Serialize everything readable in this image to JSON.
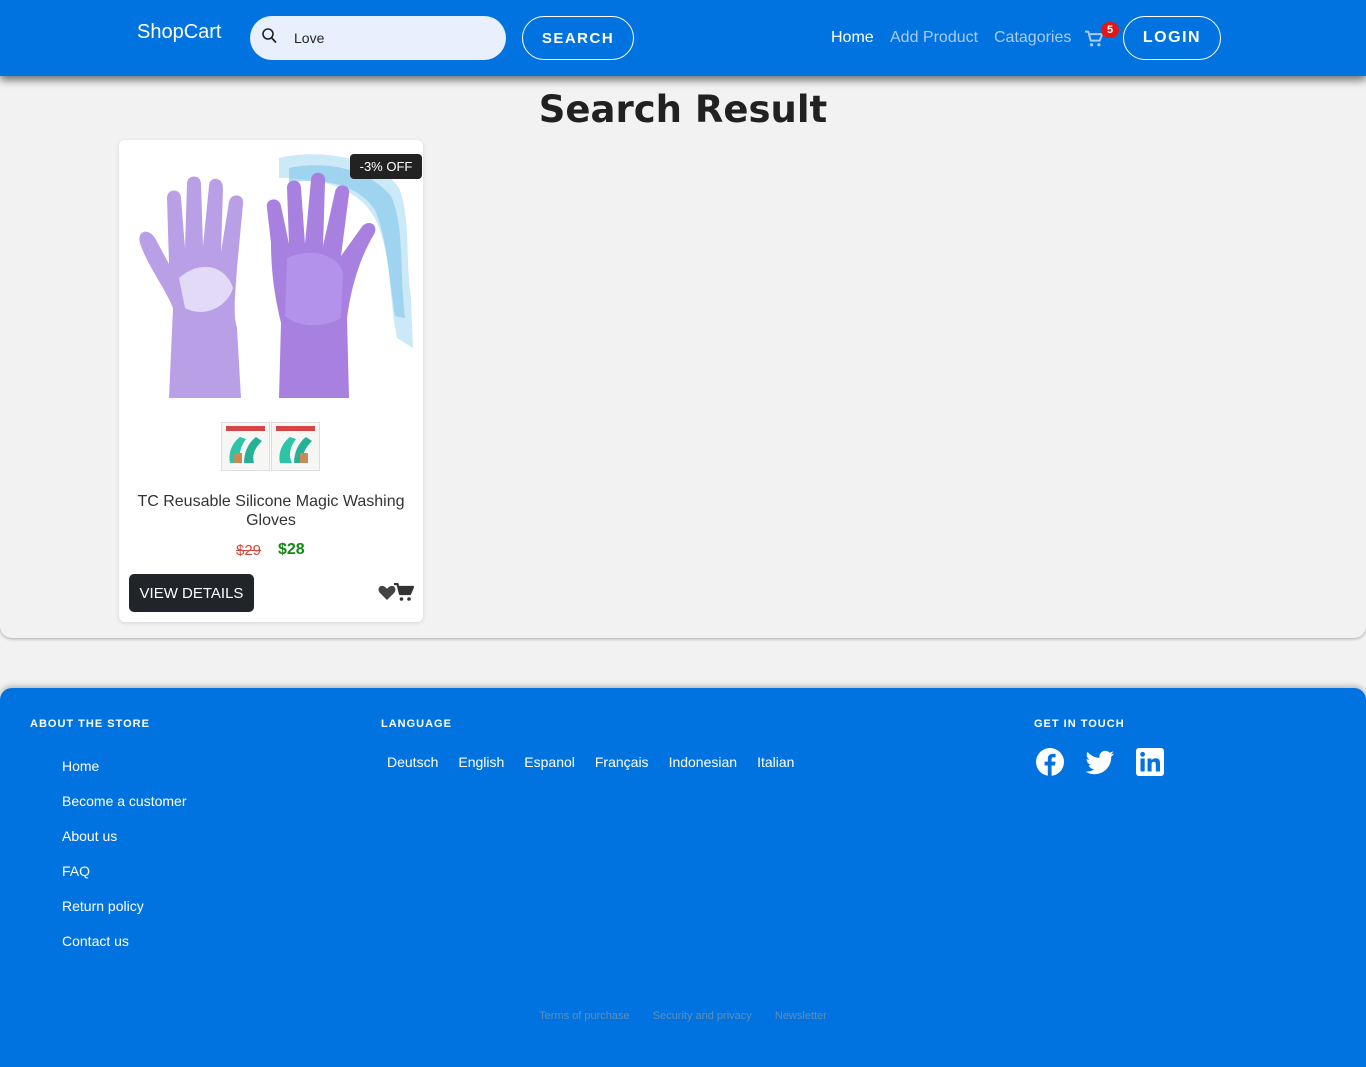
{
  "navbar": {
    "brand": "ShopCart",
    "search": {
      "value": "Love",
      "button_label": "SEARCH"
    },
    "links": [
      "Home",
      "Add Product",
      "Catagories"
    ],
    "cart_count": "5",
    "login_label": "LOGIN"
  },
  "main": {
    "title": "Search Result",
    "products": [
      {
        "badge": "-3% OFF",
        "name": "TC Reusable Silicone Magic Washing Gloves",
        "old_price": "$29",
        "new_price": "$28",
        "view_label": "VIEW DETAILS",
        "thumbnail_count": 2
      }
    ]
  },
  "footer": {
    "about_heading": "ABOUT THE STORE",
    "about_links": [
      "Home",
      "Become a customer",
      "About us",
      "FAQ",
      "Return policy",
      "Contact us"
    ],
    "language_heading": "LANGUAGE",
    "languages": [
      "Deutsch",
      "English",
      "Espanol",
      "Français",
      "Indonesian",
      "Italian"
    ],
    "contact_heading": "GET IN TOUCH",
    "social_icons": [
      "facebook-icon",
      "twitter-icon",
      "linkedin-icon"
    ],
    "legal_links": [
      "Terms of purchase",
      "Security and privacy",
      "Newsletter"
    ]
  },
  "colors": {
    "brand_blue": "#0073e0",
    "badge_red": "#e01818",
    "price_green": "#118a11",
    "price_old_red": "#d9453a",
    "dark_button": "#212529"
  }
}
